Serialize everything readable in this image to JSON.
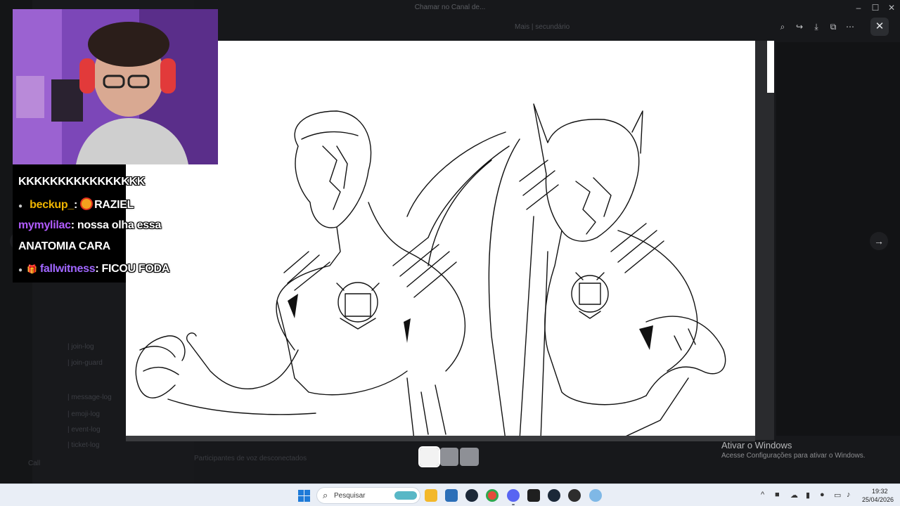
{
  "window": {
    "title": "Chamar no Canal de..."
  },
  "background": {
    "header_text": "Mais | secundário",
    "channels": [
      "| join-log",
      "| join-guard",
      "| message-log",
      "| emoji-log",
      "| event-log",
      "| ticket-log"
    ],
    "user_label": "Call",
    "message_hint": "Participantes de voz desconectados"
  },
  "chat_overlay": {
    "lines": [
      {
        "user": "",
        "message": "KKKKKKKKKKKKKKKK"
      },
      {
        "user": "beckup_",
        "separator": ":",
        "message": "RAZIEL"
      },
      {
        "user": "mymylilac",
        "separator": ":",
        "message": "nossa olha essa"
      },
      {
        "user": "",
        "message": "ANATOMIA CARA"
      },
      {
        "user": "fallwitness",
        "separator": ":",
        "message": "FICOU FODA"
      }
    ]
  },
  "watermark": {
    "title": "Ativar o Windows",
    "subtitle": "Acesse Configurações para ativar o Windows."
  },
  "taskbar": {
    "search_placeholder": "Pesquisar",
    "time": "19:32",
    "date": "25/04/2026"
  },
  "icons": {
    "zoom": "zoom-icon",
    "share": "share-icon",
    "download": "download-icon",
    "open": "open-external-icon",
    "more": "more-icon",
    "close": "close-icon"
  }
}
